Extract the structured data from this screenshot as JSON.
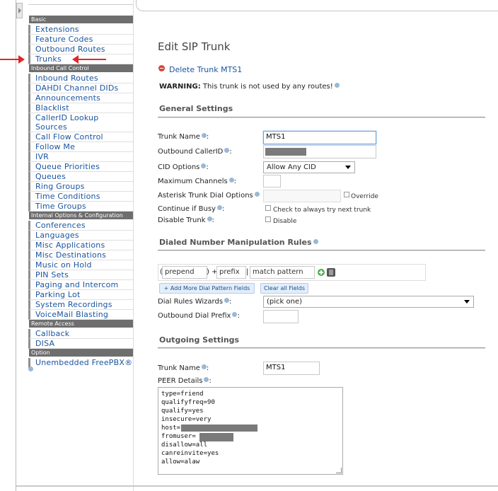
{
  "sidebar": {
    "sections": [
      {
        "title": "Basic",
        "items": [
          "Extensions",
          "Feature Codes",
          "Outbound Routes",
          "Trunks"
        ]
      },
      {
        "title": "Inbound Call Control",
        "items": [
          "Inbound Routes",
          "DAHDI Channel DIDs",
          "Announcements",
          "Blacklist",
          "CallerID Lookup Sources",
          "Call Flow Control",
          "Follow Me",
          "IVR",
          "Queue Priorities",
          "Queues",
          "Ring Groups",
          "Time Conditions",
          "Time Groups"
        ]
      },
      {
        "title": "Internal Options & Configuration",
        "items": [
          "Conferences",
          "Languages",
          "Misc Applications",
          "Misc Destinations",
          "Music on Hold",
          "PIN Sets",
          "Paging and Intercom",
          "Parking Lot",
          "System Recordings",
          "VoiceMail Blasting"
        ]
      },
      {
        "title": "Remote Access",
        "items": [
          "Callback",
          "DISA"
        ]
      },
      {
        "title": "Option",
        "items": [
          "Unembedded FreePBX®"
        ]
      }
    ]
  },
  "page": {
    "title": "Edit SIP Trunk",
    "delete_link": "Delete Trunk MTS1",
    "warning_label": "WARNING:",
    "warning_text": "This trunk is not used by any routes!"
  },
  "general": {
    "heading": "General Settings",
    "trunk_name_label": "Trunk Name",
    "trunk_name_value": "MTS1",
    "callerid_label": "Outbound CallerID",
    "cid_options_label": "CID Options",
    "cid_options_value": "Allow Any CID",
    "max_channels_label": "Maximum Channels",
    "dial_options_label": "Asterisk Trunk Dial Options",
    "override_label": "Override",
    "continue_busy_label": "Continue if Busy",
    "continue_busy_check": "Check to always try next trunk",
    "disable_trunk_label": "Disable Trunk",
    "disable_check": "Disable"
  },
  "dialrules": {
    "heading": "Dialed Number Manipulation Rules",
    "prepend_placeholder": "prepend",
    "prefix_placeholder": "prefix",
    "pattern_placeholder": "match pattern",
    "open_paren": "(",
    "close_paren_plus": ") +",
    "pipe": "|",
    "add_button": "+ Add More Dial Pattern Fields",
    "clear_button": "Clear all Fields",
    "wizards_label": "Dial Rules Wizards",
    "wizards_value": "(pick one)",
    "outbound_prefix_label": "Outbound Dial Prefix"
  },
  "outgoing": {
    "heading": "Outgoing Settings",
    "trunk_name_label": "Trunk Name",
    "trunk_name_value": "MTS1",
    "peer_label": "PEER Details",
    "peer_lines": [
      "type=friend",
      "qualifyfreq=90",
      "qualify=yes",
      "insecure=very",
      "host=",
      "fromuser=",
      "disallow=all",
      "canreinvite=yes",
      "allow=alaw"
    ]
  },
  "colors": {
    "link": "#1a55a0",
    "section": "#6e6e6e",
    "arrow": "#e0262c"
  }
}
